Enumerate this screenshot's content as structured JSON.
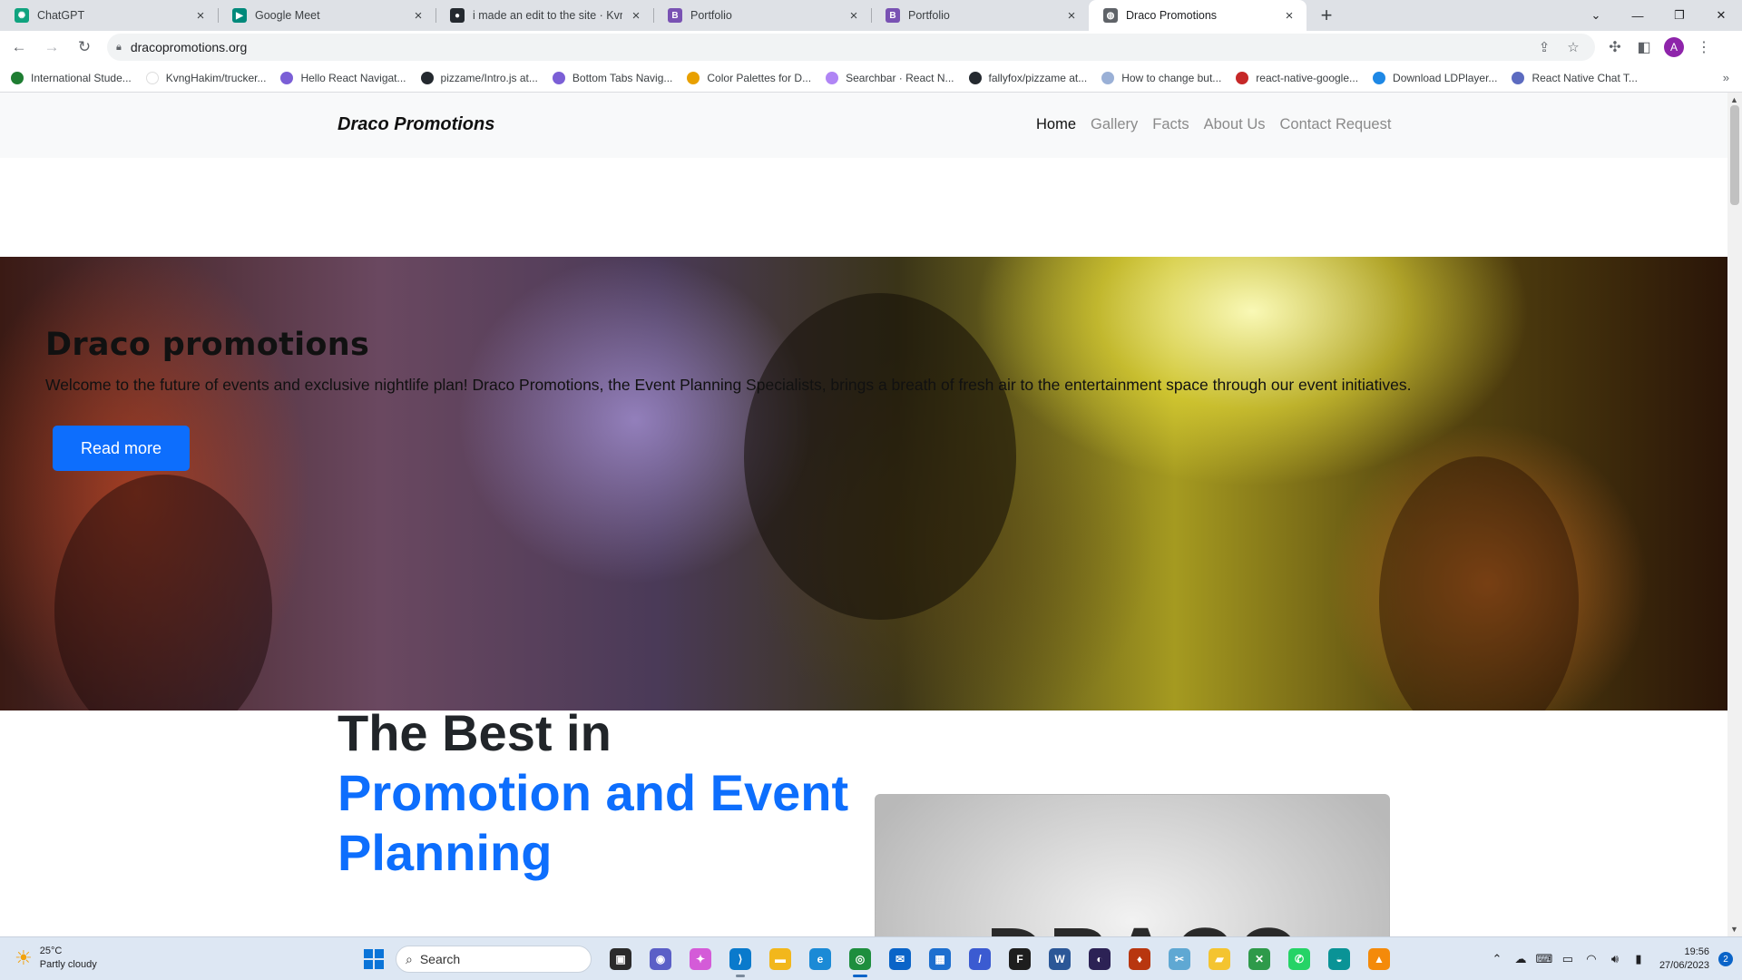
{
  "browser": {
    "tabs": [
      {
        "title": "ChatGPT",
        "icon": "chatgpt-icon",
        "color": "#10a37f",
        "glyph": "✺",
        "active": false
      },
      {
        "title": "Google Meet",
        "icon": "google-meet-icon",
        "color": "#00897b",
        "glyph": "▶",
        "active": false
      },
      {
        "title": "i made an edit to the site · KvngH",
        "icon": "github-icon",
        "color": "#24292f",
        "glyph": "●",
        "active": false
      },
      {
        "title": "Portfolio",
        "icon": "bootstrap-icon",
        "color": "#7952b3",
        "glyph": "B",
        "active": false
      },
      {
        "title": "Portfolio",
        "icon": "bootstrap-icon",
        "color": "#7952b3",
        "glyph": "B",
        "active": false
      },
      {
        "title": "Draco Promotions",
        "icon": "globe-icon",
        "color": "#5f6368",
        "glyph": "◍",
        "active": true
      }
    ],
    "url": "dracopromotions.org",
    "profile_initial": "A",
    "bookmarks": [
      {
        "label": "International Stude...",
        "color": "#1e7d32"
      },
      {
        "label": "KvngHakim/trucker...",
        "color": "#ffffff"
      },
      {
        "label": "Hello React Navigat...",
        "color": "#7b5fd6"
      },
      {
        "label": "pizzame/Intro.js at...",
        "color": "#24292f"
      },
      {
        "label": "Bottom Tabs Navig...",
        "color": "#7b5fd6"
      },
      {
        "label": "Color Palettes for D...",
        "color": "#e8a000"
      },
      {
        "label": "Searchbar · React N...",
        "color": "#b085f5"
      },
      {
        "label": "fallyfox/pizzame at...",
        "color": "#24292f"
      },
      {
        "label": "How to change but...",
        "color": "#9ab0d6"
      },
      {
        "label": "react-native-google...",
        "color": "#c62828"
      },
      {
        "label": "Download LDPlayer...",
        "color": "#1e88e5"
      },
      {
        "label": "React Native Chat T...",
        "color": "#5c6bc0"
      }
    ]
  },
  "site": {
    "brand": "Draco Promotions",
    "nav": [
      {
        "label": "Home",
        "active": true
      },
      {
        "label": "Gallery",
        "active": false
      },
      {
        "label": "Facts",
        "active": false
      },
      {
        "label": "About Us",
        "active": false
      },
      {
        "label": "Contact Request",
        "active": false
      }
    ],
    "hero": {
      "title": "Draco promotions",
      "text": "Welcome to the future of events and exclusive nightlife plan! Draco Promotions, the Event Planning Specialists, brings a breath of fresh air to the entertainment space through our event initiatives.",
      "button": "Read more"
    },
    "best": {
      "line1": "The Best in",
      "line2": "Promotion and Event",
      "line3": "Planning"
    },
    "logo_text": "DRACO",
    "accent": "#0d6efd"
  },
  "taskbar": {
    "weather_temp": "25°C",
    "weather_desc": "Partly cloudy",
    "search_placeholder": "Search",
    "apps": [
      {
        "name": "task-view-icon",
        "color": "#2b2b2b",
        "glyph": "▣",
        "state": ""
      },
      {
        "name": "teams-chat-icon",
        "color": "#5b5fc7",
        "glyph": "◉",
        "state": ""
      },
      {
        "name": "copilot-icon",
        "color": "#d45bd8",
        "glyph": "✦",
        "state": ""
      },
      {
        "name": "vscode-icon",
        "color": "#0a7acc",
        "glyph": "⟩",
        "state": "running"
      },
      {
        "name": "file-explorer-icon",
        "color": "#f2b71c",
        "glyph": "▬",
        "state": ""
      },
      {
        "name": "edge-icon",
        "color": "#1b8ad6",
        "glyph": "e",
        "state": ""
      },
      {
        "name": "chrome-icon",
        "color": "#1e8e3e",
        "glyph": "◎",
        "state": "focused"
      },
      {
        "name": "mail-icon",
        "color": "#0a64c8",
        "glyph": "✉",
        "state": ""
      },
      {
        "name": "store-icon",
        "color": "#1d6fcf",
        "glyph": "▦",
        "state": ""
      },
      {
        "name": "android-studio-icon",
        "color": "#3b5bd1",
        "glyph": "/",
        "state": ""
      },
      {
        "name": "figma-icon",
        "color": "#1e1e1e",
        "glyph": "F",
        "state": ""
      },
      {
        "name": "word-icon",
        "color": "#2b5797",
        "glyph": "W",
        "state": ""
      },
      {
        "name": "eclipse-icon",
        "color": "#2c2255",
        "glyph": "◐",
        "state": ""
      },
      {
        "name": "phoenix-app-icon",
        "color": "#b8360f",
        "glyph": "♦",
        "state": ""
      },
      {
        "name": "snipping-tool-icon",
        "color": "#5fa8d3",
        "glyph": "✂",
        "state": ""
      },
      {
        "name": "sticky-notes-icon",
        "color": "#f4c430",
        "glyph": "▰",
        "state": ""
      },
      {
        "name": "excel-like-icon",
        "color": "#2e9a4a",
        "glyph": "✕",
        "state": ""
      },
      {
        "name": "whatsapp-icon",
        "color": "#25d366",
        "glyph": "✆",
        "state": ""
      },
      {
        "name": "arc-icon",
        "color": "#0a9396",
        "glyph": "◒",
        "state": ""
      },
      {
        "name": "vlc-icon",
        "color": "#f48a0a",
        "glyph": "▲",
        "state": ""
      }
    ],
    "time": "19:56",
    "date": "27/06/2023",
    "notifications": "2"
  }
}
